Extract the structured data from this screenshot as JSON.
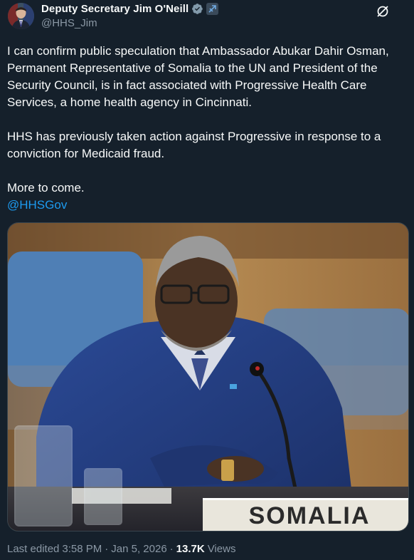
{
  "author": {
    "display_name": "Deputy Secretary Jim O'Neill",
    "handle": "@HHS_Jim"
  },
  "post": {
    "paragraph1": "I can confirm public speculation that Ambassador Abukar Dahir Osman, Permanent Representative of Somalia to the UN and President of the Security Council, is in fact associated with Progressive Health Care Services, a home health agency in Cincinnati.",
    "paragraph2": "HHS has previously taken action against Progressive in response to a conviction for Medicaid fraud.",
    "paragraph3": "More to come.",
    "mention": "@HHSGov"
  },
  "media": {
    "nameplate_text": "SOMALIA"
  },
  "footer": {
    "edited_label": "Last edited",
    "time": "3:58 PM",
    "separator": "·",
    "date": "Jan 5, 2026",
    "views_count": "13.7K",
    "views_label": "Views"
  },
  "colors": {
    "background": "#15202b",
    "text": "#f7f9f9",
    "secondary_text": "#8b98a5",
    "link": "#1d9bf0",
    "verified": "#829aab"
  },
  "icons": [
    "verified-badge-icon",
    "government-badge-icon",
    "grok-icon"
  ]
}
